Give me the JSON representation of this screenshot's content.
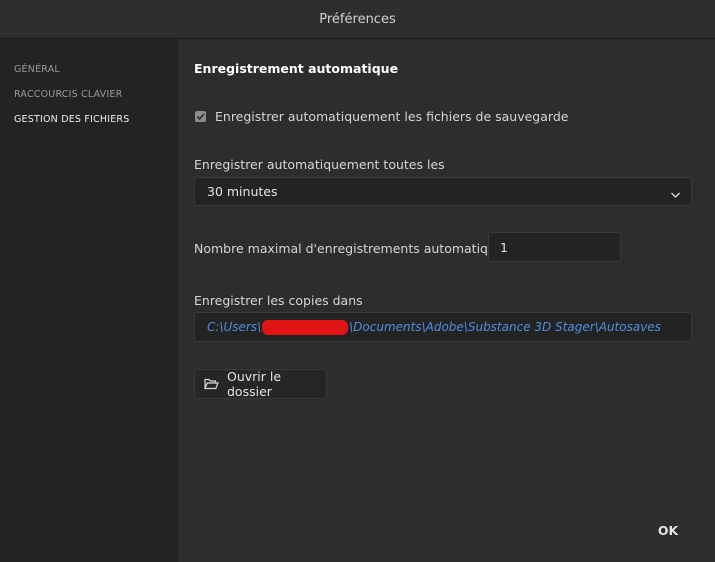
{
  "window": {
    "title": "Préférences"
  },
  "sidebar": {
    "items": [
      {
        "label": "GÉNÉRAL"
      },
      {
        "label": "RACCOURCIS CLAVIER"
      },
      {
        "label": "GESTION DES FICHIERS",
        "active": true
      }
    ]
  },
  "autosave": {
    "section_title": "Enregistrement automatique",
    "enable_label": "Enregistrer automatiquement les fichiers de sauvegarde",
    "enable_checked": true,
    "interval_label": "Enregistrer automatiquement toutes les",
    "interval_value": "30 minutes",
    "max_label": "Nombre maximal d'enregistrements automatiques",
    "max_value": "1",
    "location_label": "Enregistrer les copies dans",
    "path_prefix": "C:\\Users\\",
    "path_suffix": "\\Documents\\Adobe\\Substance 3D Stager\\Autosaves",
    "open_folder_label": "Ouvrir le dossier"
  },
  "footer": {
    "ok_label": "OK"
  },
  "colors": {
    "path_link": "#4f8fe0",
    "redaction": "#e01414",
    "background": "#2d2d2d",
    "sidebar": "#232323"
  },
  "icons": {
    "checkbox": "check-icon",
    "dropdown": "chevron-down-icon",
    "folder": "folder-open-icon"
  }
}
